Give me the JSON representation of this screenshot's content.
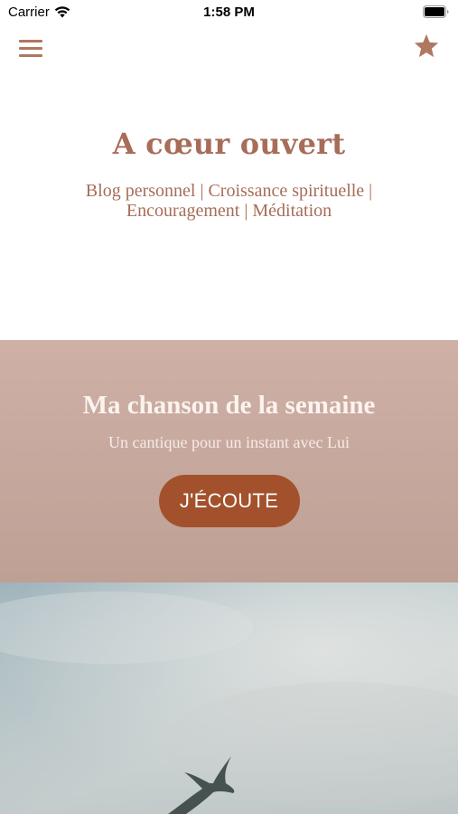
{
  "status_bar": {
    "carrier": "Carrier",
    "time": "1:58 PM"
  },
  "nav": {
    "menu_icon": "hamburger-menu-icon",
    "favorite_icon": "star-icon",
    "icon_color": "#b07860"
  },
  "hero": {
    "title": "A cœur ouvert",
    "tagline": "Blog personnel | Croissance spirituelle | Encouragement | Méditation"
  },
  "song_of_week": {
    "title": "Ma chanson de la semaine",
    "subtitle": "Un cantique pour un instant avec Lui",
    "button_label": "J'ÉCOUTE",
    "background_color": "#c6a79c",
    "button_color": "#a3512d"
  },
  "feature_image": {
    "subject": "bird-in-sky-photo"
  }
}
